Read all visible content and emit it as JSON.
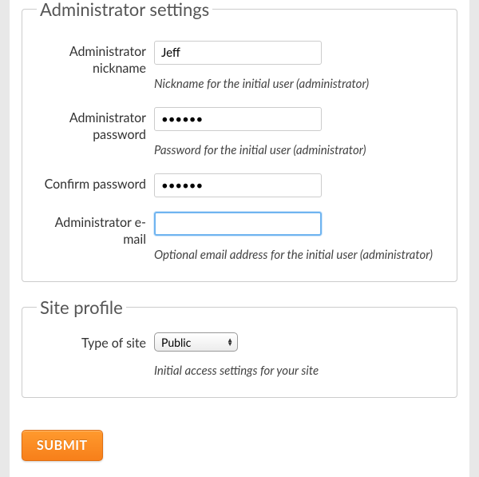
{
  "admin_section": {
    "legend": "Administrator settings",
    "nickname": {
      "label": "Administrator nickname",
      "value": "Jeff",
      "help": "Nickname for the initial user (administrator)"
    },
    "password": {
      "label": "Administrator password",
      "value": "••••••",
      "help": "Password for the initial user (administrator)"
    },
    "confirm_password": {
      "label": "Confirm password",
      "value": "••••••"
    },
    "email": {
      "label": "Administrator e-mail",
      "value": "",
      "help": "Optional email address for the initial user (administrator)"
    }
  },
  "site_section": {
    "legend": "Site profile",
    "type": {
      "label": "Type of site",
      "selected": "Public",
      "help": "Initial access settings for your site"
    }
  },
  "submit": {
    "label": "SUBMIT"
  }
}
